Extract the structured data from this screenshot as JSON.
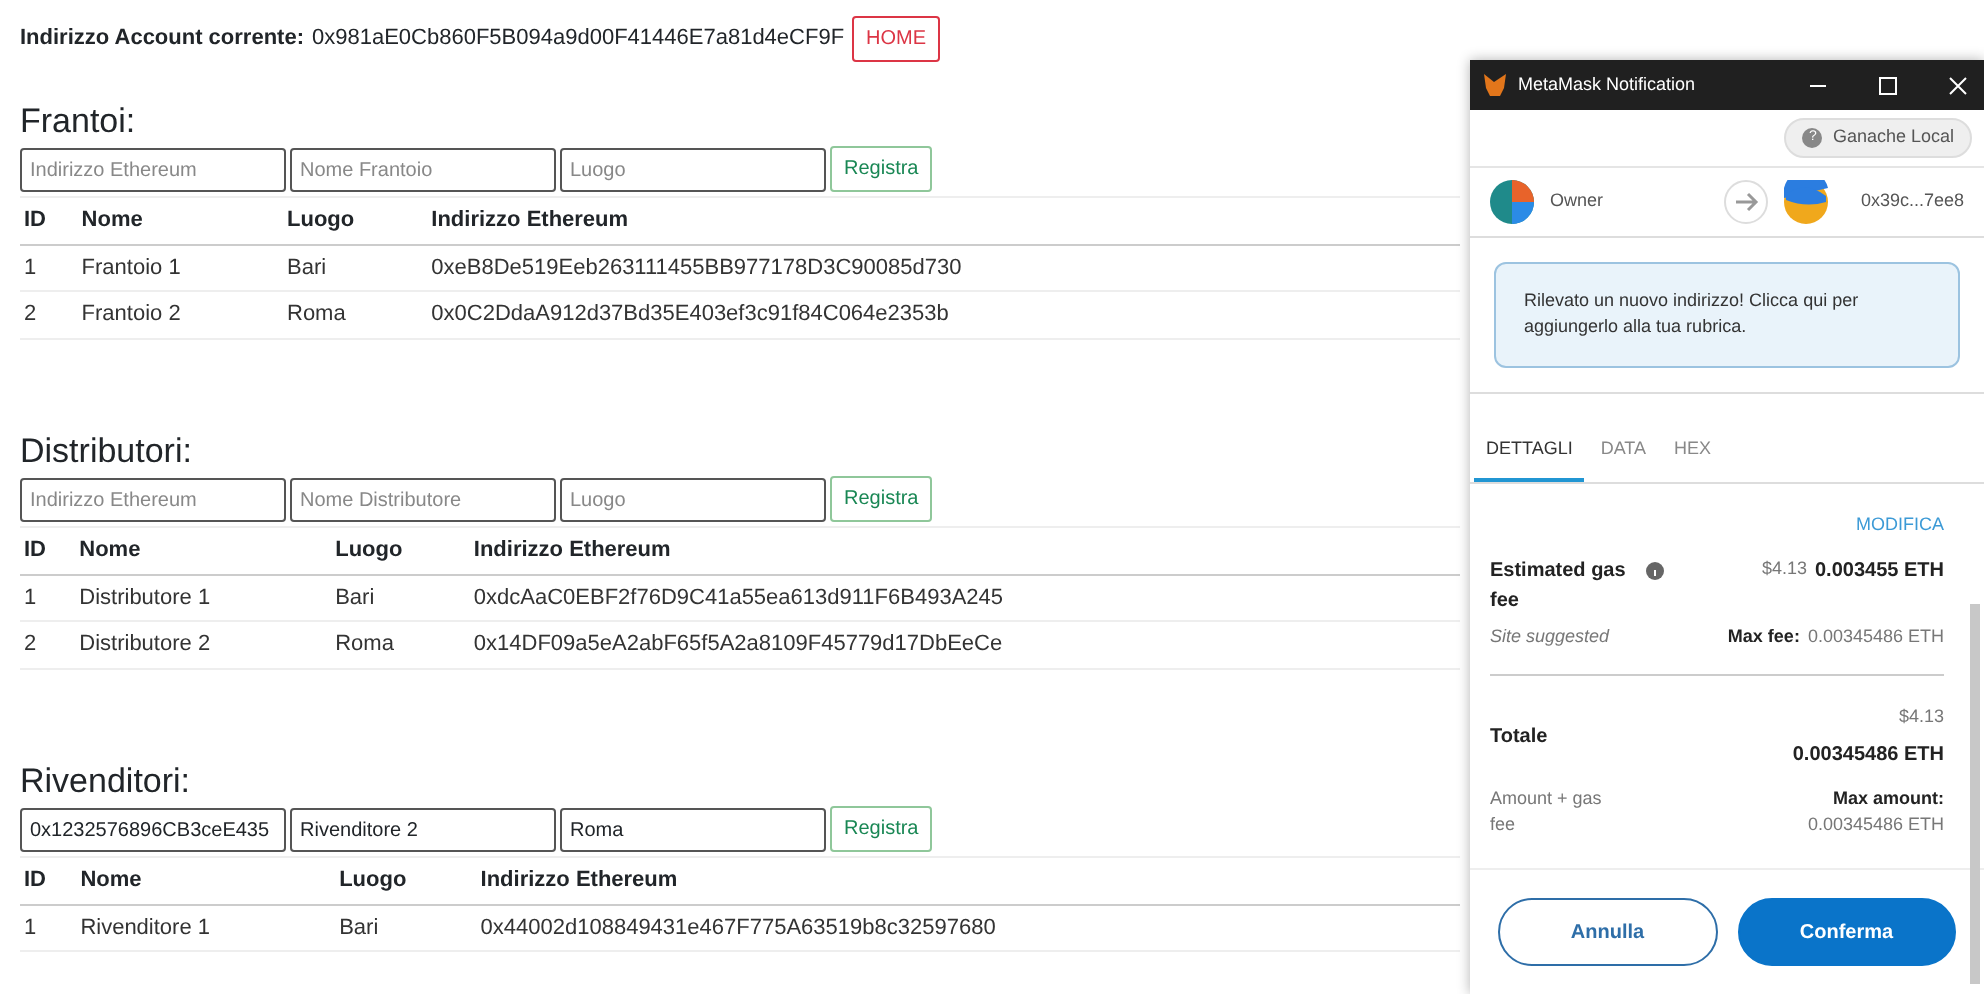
{
  "header": {
    "label": "Indirizzo Account corrente:",
    "address": "0x981aE0Cb860F5B094a9d00F41446E7a81d4eCF9F",
    "home_button": "HOME"
  },
  "sections": [
    {
      "title": "Frantoi:",
      "fields": [
        {
          "placeholder": "Indirizzo Ethereum"
        },
        {
          "placeholder": "Nome Frantoio"
        },
        {
          "placeholder": "Luogo"
        }
      ],
      "submit": "Registra",
      "columns": [
        "ID",
        "Nome",
        "Luogo",
        "Indirizzo Ethereum"
      ],
      "rows": [
        [
          "1",
          "Frantoio 1",
          "Bari",
          "0xeB8De519Eeb263111455BB977178D3C90085d730"
        ],
        [
          "2",
          "Frantoio 2",
          "Roma",
          "0x0C2DdaA912d37Bd35E403ef3c91f84C064e2353b"
        ]
      ]
    },
    {
      "title": "Distributori:",
      "fields": [
        {
          "placeholder": "Indirizzo Ethereum"
        },
        {
          "placeholder": "Nome Distributore"
        },
        {
          "placeholder": "Luogo"
        }
      ],
      "submit": "Registra",
      "columns": [
        "ID",
        "Nome",
        "Luogo",
        "Indirizzo Ethereum"
      ],
      "rows": [
        [
          "1",
          "Distributore 1",
          "Bari",
          "0xdcAaC0EBF2f76D9C41a55ea613d911F6B493A245"
        ],
        [
          "2",
          "Distributore 2",
          "Roma",
          "0x14DF09a5eA2abF65f5A2a8109F45779d17DbEeCe"
        ]
      ]
    },
    {
      "title": "Rivenditori:",
      "fields": [
        {
          "value": "0x1232576896CB3ceE435"
        },
        {
          "value": "Rivenditore 2"
        },
        {
          "value": "Roma"
        }
      ],
      "submit": "Registra",
      "columns": [
        "ID",
        "Nome",
        "Luogo",
        "Indirizzo Ethereum"
      ],
      "rows": [
        [
          "1",
          "Rivenditore 1",
          "Bari",
          "0x44002d108849431e467F775A63519b8c32597680"
        ]
      ]
    }
  ],
  "popup": {
    "title": "MetaMask Notification",
    "network": "Ganache Local",
    "network_icon": "?",
    "from": "Owner",
    "to": "0x39c...7ee8",
    "alert": "Rilevato un nuovo indirizzo! Clicca qui per aggiungerlo alla tua rubrica.",
    "tabs": [
      {
        "label": "DETTAGLI",
        "selected": true
      },
      {
        "label": "DATA",
        "selected": false
      },
      {
        "label": "HEX",
        "selected": false
      }
    ],
    "edit_link": "MODIFICA",
    "gas_label": "Estimated gas fee",
    "gas_fiat": "$4.13",
    "gas_eth": "0.003455 ETH",
    "gas_note": "Site suggested",
    "max_fee_label": "Max fee:",
    "max_fee": "0.00345486 ETH",
    "total_label": "Totale",
    "total_fiat": "$4.13",
    "total_eth": "0.00345486 ETH",
    "total_note": "Amount + gas fee",
    "max_amount_label": "Max amount:",
    "max_amount": "0.00345486 ETH",
    "buttons": [
      {
        "label": "Annulla",
        "kind": "secondary"
      },
      {
        "label": "Conferma",
        "kind": "primary"
      }
    ]
  }
}
